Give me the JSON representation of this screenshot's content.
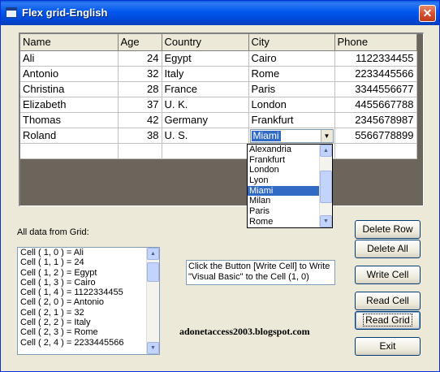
{
  "window": {
    "title": "Flex grid-English",
    "close_glyph": "✕"
  },
  "grid": {
    "headers": [
      "Name",
      "Age",
      "Country",
      "City",
      "Phone"
    ],
    "rows": [
      [
        "Ali",
        "24",
        "Egypt",
        "Cairo",
        "1122334455"
      ],
      [
        "Antonio",
        "32",
        "Italy",
        "Rome",
        "2233445566"
      ],
      [
        "Christina",
        "28",
        "France",
        "Paris",
        "3344556677"
      ],
      [
        "Elizabeth",
        "37",
        "U. K.",
        "London",
        "4455667788"
      ],
      [
        "Thomas",
        "42",
        "Germany",
        "Frankfurt",
        "2345678987"
      ],
      [
        "Roland",
        "38",
        "U. S.",
        "Miami",
        "5566778899"
      ]
    ]
  },
  "city_dropdown": {
    "selected": "Miami",
    "options": [
      "Alexandria",
      "Frankfurt",
      "London",
      "Lyon",
      "Miami",
      "Milan",
      "Paris",
      "Rome"
    ]
  },
  "all_data_label": "All data from Grid:",
  "list_items": [
    "Cell ( 1,  0 )  =  Ali",
    "Cell ( 1,  1 )  =  24",
    "Cell ( 1,  2 )  =  Egypt",
    "Cell ( 1,  3 )  =  Cairo",
    "Cell ( 1,  4 )  =  1122334455",
    "Cell ( 2,  0 )  =  Antonio",
    "Cell ( 2,  1 )  =  32",
    "Cell ( 2,  2 )  =  Italy",
    "Cell ( 2,  3 )  =  Rome",
    "Cell ( 2,  4 )  =  2233445566"
  ],
  "info_text": "Click the Button [Write Cell] to Write \"Visual Basic\" to the Cell (1, 0)",
  "blog": "adonetaccess2003.blogspot.com",
  "buttons": {
    "delete_row": "Delete Row",
    "delete_all": "Delete All",
    "write_cell": "Write Cell",
    "read_cell": "Read Cell",
    "read_grid": "Read Grid",
    "exit": "Exit"
  },
  "scroll_glyphs": {
    "up": "▲",
    "down": "▼"
  },
  "icons": {
    "app": "app-icon",
    "close": "close-icon",
    "dropdown": "chevron-down-icon"
  },
  "colors": {
    "titlebar": "#0058ee",
    "selection": "#316ac5",
    "grid_background": "#6c655c",
    "window": "#ece9d8"
  }
}
